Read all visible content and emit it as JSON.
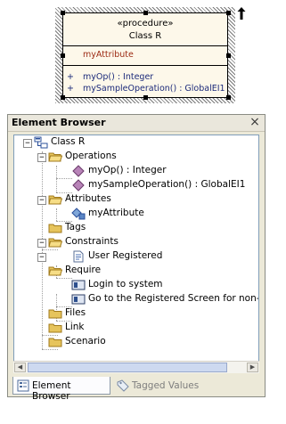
{
  "diagram_element": {
    "stereotype": "«procedure»",
    "name": "Class R",
    "attribute": "myAttribute",
    "operations": [
      {
        "visibility": "+",
        "signature": "myOp() : Integer"
      },
      {
        "visibility": "+",
        "signature": "mySampleOperation() : GlobalEI1"
      }
    ]
  },
  "browser": {
    "title": "Element Browser",
    "close_glyph": "×",
    "tree": {
      "root": "Class R",
      "operations_label": "Operations",
      "operations": [
        "myOp() : Integer",
        "mySampleOperation() : GlobalEI1"
      ],
      "attributes_label": "Attributes",
      "attributes": [
        "myAttribute"
      ],
      "tags_label": "Tags",
      "constraints_label": "Constraints",
      "constraints": [
        "User Registered"
      ],
      "require_label": "Require",
      "requirements": [
        "Login to system",
        "Go to the Registered Screen for non-son"
      ],
      "files_label": "Files",
      "link_label": "Link",
      "scenario_label": "Scenario"
    },
    "tabs": [
      {
        "label": "Element Browser",
        "icon": "element-browser-icon",
        "active": true
      },
      {
        "label": "Tagged Values",
        "icon": "tag-icon",
        "active": false
      }
    ]
  },
  "colors": {
    "uml_fill": "#fdf8ea",
    "attribute_text": "#9c2a12",
    "operation_text": "#1c2a7a",
    "folder": "#e6c45c"
  }
}
